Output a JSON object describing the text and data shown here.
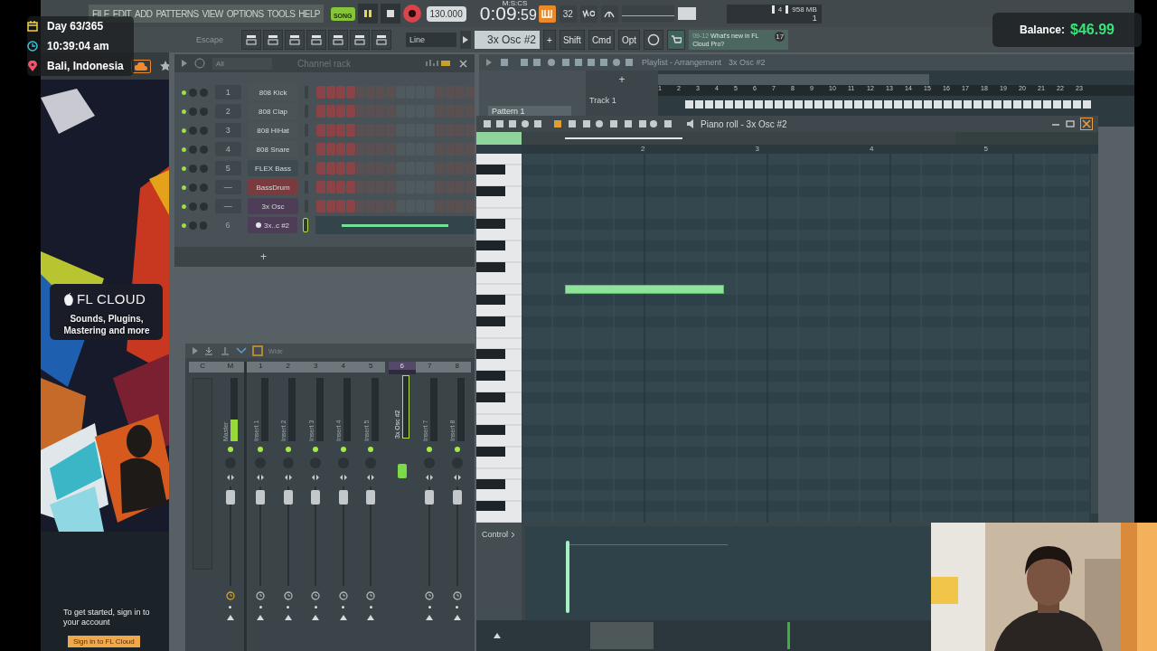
{
  "overlay": {
    "day": "Day 63/365",
    "time": "10:39:04 am",
    "location": "Bali, Indonesia",
    "balance_label": "Balance:",
    "balance": "$46.99"
  },
  "menu": [
    "FILE",
    "EDIT",
    "ADD",
    "PATTERNS",
    "VIEW",
    "OPTIONS",
    "TOOLS",
    "HELP"
  ],
  "transport": {
    "mode": "SONG",
    "tempo": "130.000",
    "time_main": "0:09",
    "time_sub": ":59",
    "time_unit": "M:S:CS",
    "step": "32",
    "cpu_voices": "4",
    "memory": "958 MB",
    "cpu_count": "1"
  },
  "toolbar": {
    "escape": "Escape",
    "snap": "Line",
    "pattern": "3x Osc #2",
    "add": "+",
    "keys": [
      "Shift",
      "Cmd",
      "Opt"
    ],
    "news_date": "09-12",
    "news": "What's new in FL Cloud Pro?",
    "news_badge": "17"
  },
  "browser": {
    "brand": "FL CLOUD",
    "tagline": "Sounds, Plugins, Mastering and more",
    "prompt": "To get started, sign in to your account",
    "sign_in": "Sign in to FL Cloud"
  },
  "channel_rack": {
    "filter": "All",
    "title": "Channel rack",
    "add": "+",
    "channels": [
      {
        "number": "1",
        "name": "808 Kick",
        "color": "#4a5457",
        "kind": "steps",
        "warning": false,
        "selected": false,
        "steps": [
          true,
          true,
          true,
          true,
          false,
          false,
          false,
          false,
          false,
          false,
          false,
          false,
          false,
          false,
          false,
          false
        ]
      },
      {
        "number": "2",
        "name": "808 Clap",
        "color": "#4a5457",
        "kind": "steps",
        "warning": false,
        "selected": false,
        "steps": [
          true,
          true,
          true,
          true,
          false,
          false,
          false,
          false,
          false,
          false,
          false,
          false,
          false,
          false,
          false,
          false
        ]
      },
      {
        "number": "3",
        "name": "808 HiHat",
        "color": "#4a5457",
        "kind": "steps",
        "warning": false,
        "selected": false,
        "steps": [
          true,
          true,
          true,
          true,
          false,
          false,
          false,
          false,
          false,
          false,
          false,
          false,
          false,
          false,
          false,
          false
        ]
      },
      {
        "number": "4",
        "name": "808 Snare",
        "color": "#4a5457",
        "kind": "steps",
        "warning": false,
        "selected": false,
        "steps": [
          true,
          true,
          true,
          true,
          false,
          false,
          false,
          false,
          false,
          false,
          false,
          false,
          false,
          false,
          false,
          false
        ]
      },
      {
        "number": "5",
        "name": "FLEX Bass",
        "color": "#3f4a50",
        "kind": "steps",
        "warning": false,
        "selected": false,
        "steps": [
          true,
          true,
          true,
          true,
          false,
          false,
          false,
          false,
          false,
          false,
          false,
          false,
          false,
          false,
          false,
          false
        ]
      },
      {
        "number": "—",
        "name": "BassDrum",
        "color": "#7a3b3e",
        "kind": "steps",
        "warning": false,
        "selected": false,
        "steps": [
          true,
          true,
          true,
          true,
          false,
          false,
          false,
          false,
          false,
          false,
          false,
          false,
          false,
          false,
          false,
          false
        ]
      },
      {
        "number": "—",
        "name": "3x Osc",
        "color": "#4d3d57",
        "kind": "steps",
        "warning": false,
        "selected": false,
        "steps": [
          true,
          true,
          true,
          true,
          false,
          false,
          false,
          false,
          false,
          false,
          false,
          false,
          false,
          false,
          false,
          false
        ]
      },
      {
        "number": "6",
        "name": "3x..c #2",
        "color": "#4d3d57",
        "kind": "notes",
        "warning": true,
        "selected": true
      }
    ]
  },
  "mixer": {
    "mode": "Wide",
    "scale_header": "C",
    "tracks": [
      {
        "label": "M",
        "name": "Master",
        "kind": "master",
        "selected": false
      },
      {
        "label": "1",
        "name": "Insert 1",
        "kind": "insert",
        "selected": false
      },
      {
        "label": "2",
        "name": "Insert 2",
        "kind": "insert",
        "selected": false
      },
      {
        "label": "3",
        "name": "Insert 3",
        "kind": "insert",
        "selected": false
      },
      {
        "label": "4",
        "name": "Insert 4",
        "kind": "insert",
        "selected": false
      },
      {
        "label": "5",
        "name": "Insert 5",
        "kind": "insert",
        "selected": false
      },
      {
        "label": "6",
        "name": "3x Osc #2",
        "kind": "insert",
        "selected": true
      },
      {
        "label": "7",
        "name": "Insert 7",
        "kind": "insert",
        "selected": false
      },
      {
        "label": "8",
        "name": "Insert 8",
        "kind": "insert",
        "selected": false
      }
    ]
  },
  "playlist": {
    "title": "Playlist - Arrangement",
    "pattern_title": "3x Osc #2",
    "pattern": "Pattern 1",
    "track": "Track 1",
    "add": "+",
    "ruler": [
      "1",
      "2",
      "3",
      "4",
      "5",
      "6",
      "7",
      "8",
      "9",
      "10",
      "11",
      "12",
      "13",
      "14",
      "15",
      "16",
      "17",
      "18",
      "19",
      "20",
      "21",
      "22",
      "23"
    ]
  },
  "piano_roll": {
    "title": "Piano roll - 3x Osc #2",
    "ruler": [
      "2",
      "3",
      "4",
      "5"
    ]
  },
  "control": {
    "label": "Control"
  }
}
